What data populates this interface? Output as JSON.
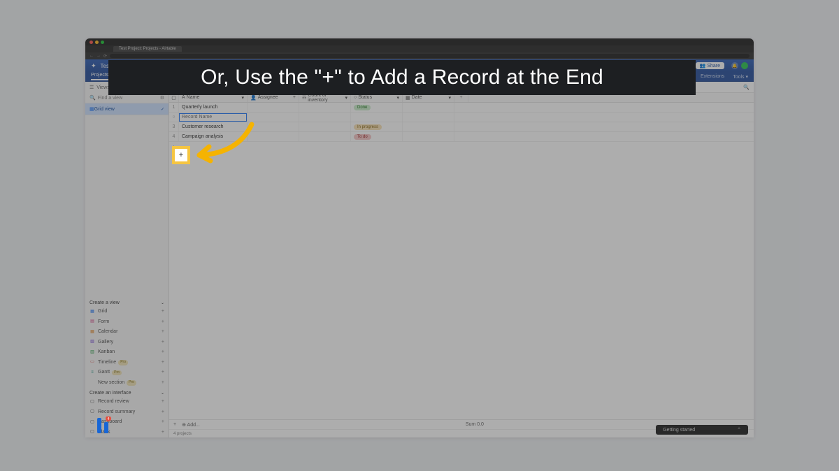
{
  "caption": "Or, Use the \"+\" to Add a Record at the End",
  "browser": {
    "tab_title": "Test Project: Projects - Airtable",
    "nav_back": "←",
    "nav_fwd": "→",
    "nav_reload": "⟳"
  },
  "app": {
    "title": "Test Project",
    "share": "Share",
    "tabs": {
      "projects": "Projects"
    },
    "rightlinks": {
      "extensions": "Extensions",
      "tools": "Tools"
    }
  },
  "sidebar": {
    "views_label": "Views",
    "find_placeholder": "Find a view",
    "grid_view": "Grid view",
    "create_view": "Create a view",
    "items": [
      {
        "label": "Grid",
        "icon": "▦",
        "cls": "ic-grid"
      },
      {
        "label": "Form",
        "icon": "▤",
        "cls": "ic-form"
      },
      {
        "label": "Calendar",
        "icon": "▦",
        "cls": "ic-cal"
      },
      {
        "label": "Gallery",
        "icon": "▧",
        "cls": "ic-gal"
      },
      {
        "label": "Kanban",
        "icon": "▥",
        "cls": "ic-kan"
      },
      {
        "label": "Timeline",
        "icon": "▭",
        "cls": "ic-tl",
        "badge": "Pro"
      },
      {
        "label": "Gantt",
        "icon": "≡",
        "cls": "ic-gantt",
        "badge": "Pro"
      },
      {
        "label": "New section",
        "icon": "",
        "cls": "",
        "badge": "Pro"
      }
    ],
    "create_interface": "Create an interface",
    "interfaces": [
      {
        "label": "Record review"
      },
      {
        "label": "Record summary"
      },
      {
        "label": "Dashboard"
      },
      {
        "label": "Blank"
      }
    ]
  },
  "grid": {
    "headers": {
      "name": "Name",
      "assignee": "Assignee",
      "count": "Count of inventory",
      "status": "Status",
      "date": "Date"
    },
    "rows": [
      {
        "n": "1",
        "name": "Quarterly launch",
        "status": "Done",
        "status_cls": "st-done"
      },
      {
        "n": "",
        "name_placeholder": "Record Name",
        "editing": true
      },
      {
        "n": "3",
        "name": "Customer research",
        "status": "In progress",
        "status_cls": "st-prog"
      },
      {
        "n": "4",
        "name": "Campaign analysis",
        "status": "To do",
        "status_cls": "st-todo"
      }
    ],
    "footer": {
      "add": "Add...",
      "count": "4 projects",
      "sum": "Sum 0.0"
    }
  },
  "getting_started": "Getting started",
  "highlight_plus": "+"
}
